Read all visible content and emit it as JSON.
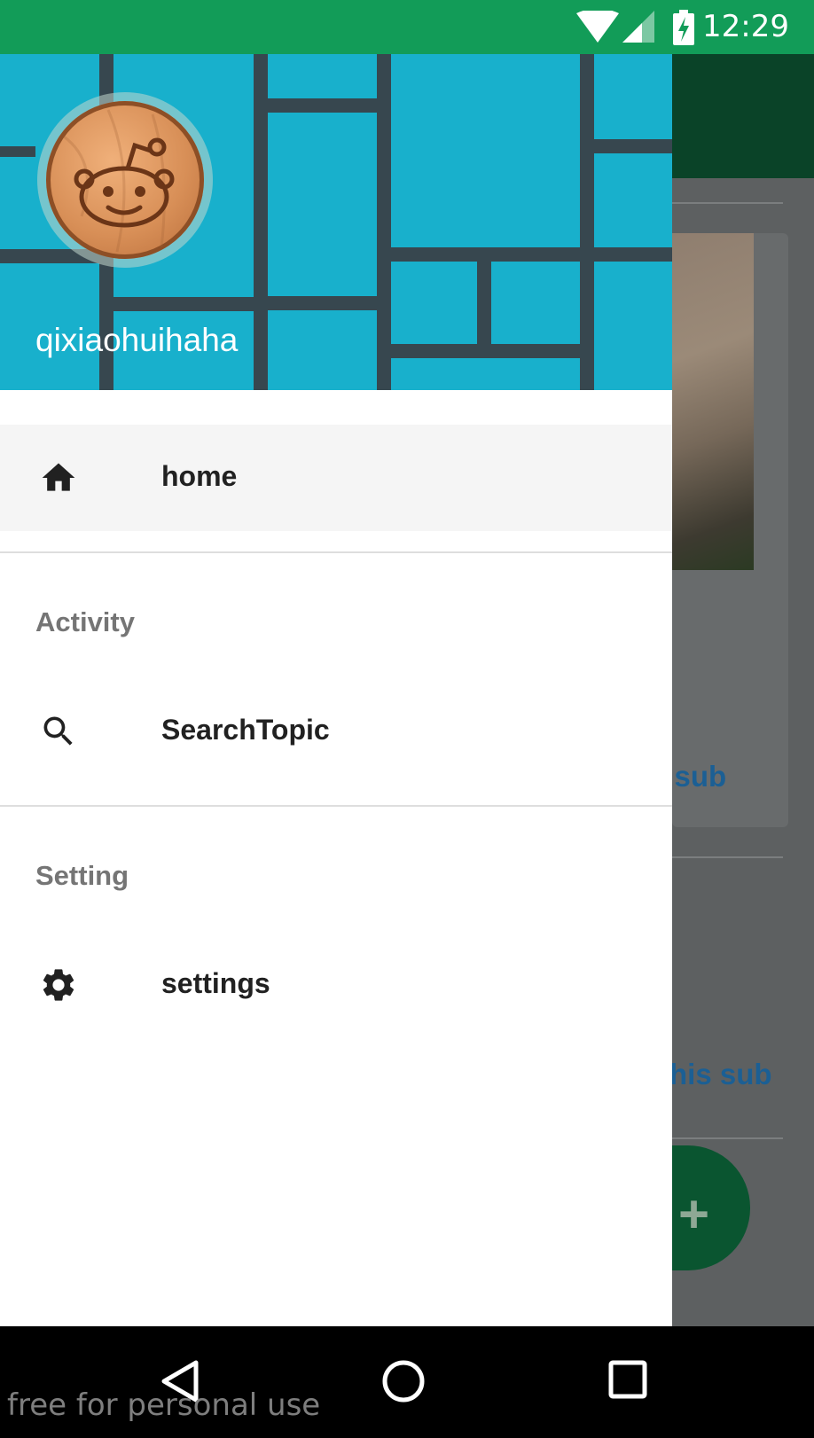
{
  "status_bar": {
    "time": "12:29",
    "color": "#129c58",
    "icons": [
      "wifi-icon",
      "signal-icon",
      "battery-charging-icon"
    ]
  },
  "drawer": {
    "header": {
      "username": "qixiaohuihaha",
      "background": "#18b0cc",
      "avatar_icon": "reddit-alien-icon"
    },
    "home": {
      "label": "home",
      "icon": "home-icon"
    },
    "sections": [
      {
        "title": "Activity",
        "items": [
          {
            "label": "SearchTopic",
            "icon": "search-icon"
          }
        ]
      },
      {
        "title": "Setting",
        "items": [
          {
            "label": "settings",
            "icon": "gear-icon"
          }
        ]
      }
    ]
  },
  "background_app": {
    "links": [
      "s sub",
      "this sub"
    ],
    "accent": "#0a5530",
    "fab_icon": "plus-icon"
  },
  "navigation_bar": {
    "icons": [
      "back-icon",
      "home-circle-icon",
      "recents-icon"
    ]
  },
  "watermark": "free for personal use"
}
